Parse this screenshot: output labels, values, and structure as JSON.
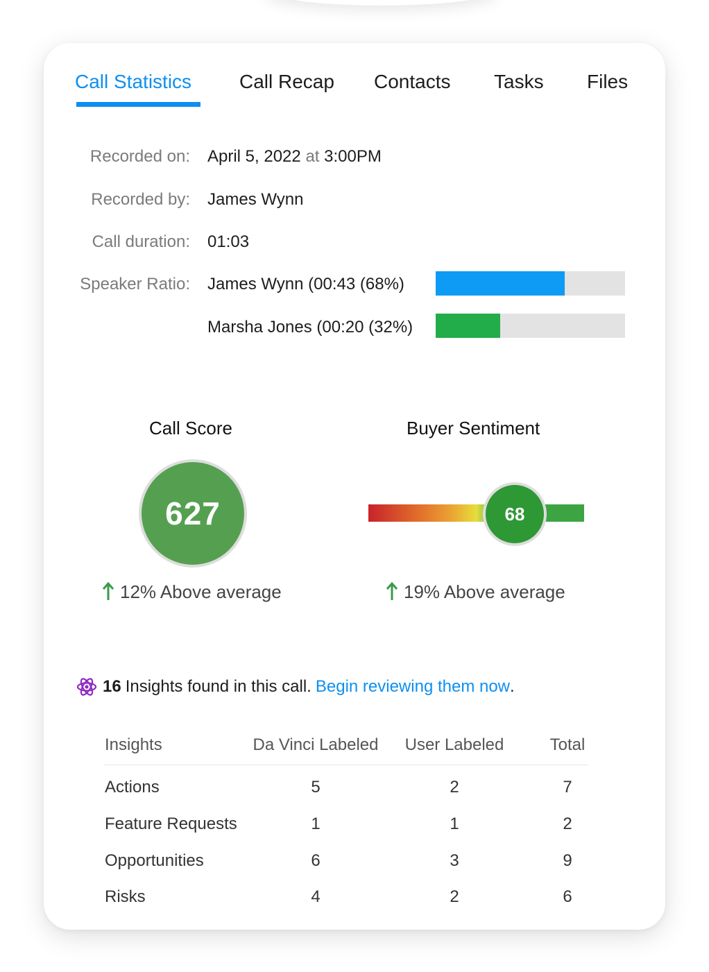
{
  "tabs": [
    {
      "label": "Call Statistics",
      "active": true
    },
    {
      "label": "Call Recap",
      "active": false
    },
    {
      "label": "Contacts",
      "active": false
    },
    {
      "label": "Tasks",
      "active": false
    },
    {
      "label": "Files",
      "active": false
    }
  ],
  "call_info": {
    "recorded_on_label": "Recorded on:",
    "recorded_on_date": "April 5, 2022",
    "recorded_on_at": "at",
    "recorded_on_time": "3:00PM",
    "recorded_by_label": "Recorded by:",
    "recorded_by_value": "James Wynn",
    "duration_label": "Call duration:",
    "duration_value": "01:03",
    "speaker_ratio_label": "Speaker Ratio:",
    "speakers": [
      {
        "label": "James Wynn (00:43 (68%)",
        "ratio": 0.68,
        "color": "#0e9bf5"
      },
      {
        "label": "Marsha Jones (00:20 (32%)",
        "ratio": 0.34,
        "color": "#22ad4a"
      }
    ]
  },
  "call_score": {
    "title": "Call Score",
    "value": "627",
    "delta": "12% Above average",
    "color": "#55a050"
  },
  "buyer_sentiment": {
    "title": "Buyer Sentiment",
    "value": "68",
    "level": 0.68,
    "delta": "19% Above average",
    "color": "#2e9834"
  },
  "insights_banner": {
    "icon": "atom-icon",
    "count": "16",
    "text": "Insights found in this call.",
    "link": "Begin reviewing them now",
    "suffix": "."
  },
  "insights_table": {
    "headers": [
      "Insights",
      "Da Vinci Labeled",
      "User Labeled",
      "Total"
    ],
    "rows": [
      [
        "Actions",
        "5",
        "2",
        "7"
      ],
      [
        "Feature Requests",
        "1",
        "1",
        "2"
      ],
      [
        "Opportunities",
        "6",
        "3",
        "9"
      ],
      [
        "Risks",
        "4",
        "2",
        "6"
      ]
    ]
  },
  "colors": {
    "accent": "#0e8ff0",
    "positive": "#3a9a48",
    "insight_icon": "#8e2bc2"
  }
}
